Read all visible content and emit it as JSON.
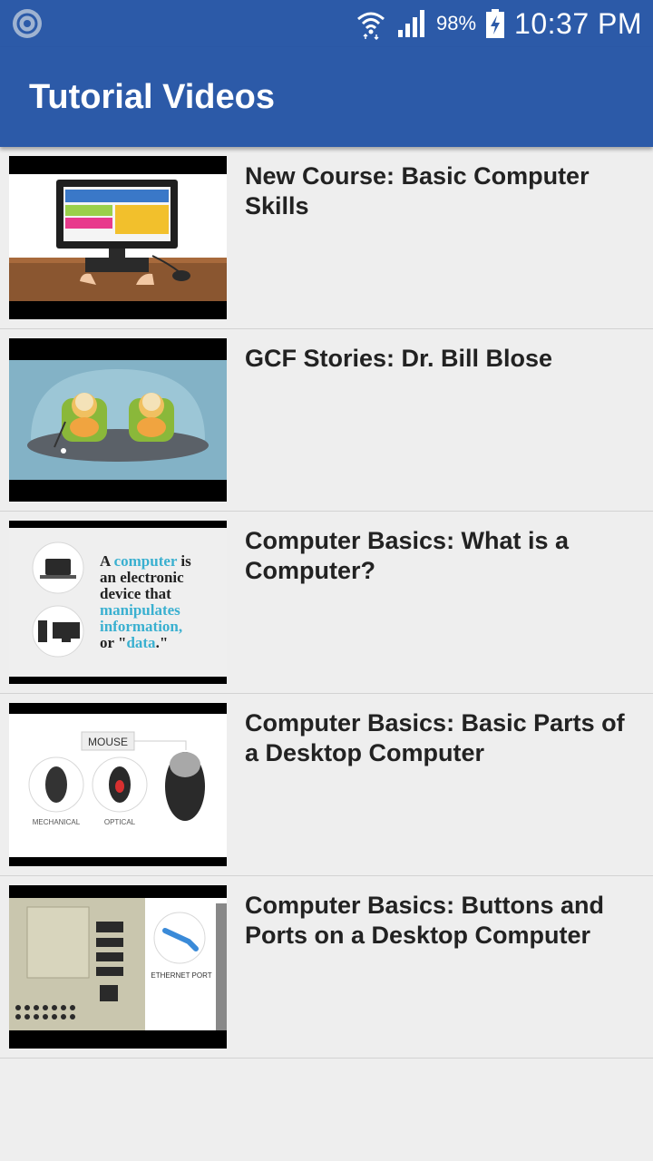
{
  "status_bar": {
    "battery_percent": "98%",
    "time": "10:37 PM",
    "icons": [
      "camera-notification-icon",
      "wifi-icon",
      "signal-icon",
      "battery-charging-icon"
    ]
  },
  "app_bar": {
    "title": "Tutorial Videos",
    "color": "#2c5aa8"
  },
  "videos": [
    {
      "title": "New Course: Basic Computer Skills",
      "thumbnail": "computer-on-desk-illustration"
    },
    {
      "title": "GCF Stories:  Dr. Bill Blose",
      "thumbnail": "cartoon-characters-in-armchairs"
    },
    {
      "title": "Computer Basics: What is a Computer?",
      "thumbnail": "computer-definition-slide",
      "thumbnail_text": {
        "line1_a": "A ",
        "line1_b": "computer",
        "line1_c": " is",
        "line2": "an electronic",
        "line3": "device that",
        "line4": "manipulates",
        "line5": "information,",
        "line6_a": "or \"",
        "line6_b": "data",
        "line6_c": ".\""
      }
    },
    {
      "title": "Computer Basics: Basic Parts of a Desktop Computer",
      "thumbnail": "computer-mouse-types",
      "thumbnail_text": {
        "heading": "MOUSE",
        "label_left": "MECHANICAL",
        "label_right": "OPTICAL"
      }
    },
    {
      "title": "Computer Basics: Buttons and Ports on a Desktop Computer",
      "thumbnail": "desktop-back-panel-ports",
      "thumbnail_text": {
        "label": "ETHERNET PORT"
      }
    }
  ]
}
